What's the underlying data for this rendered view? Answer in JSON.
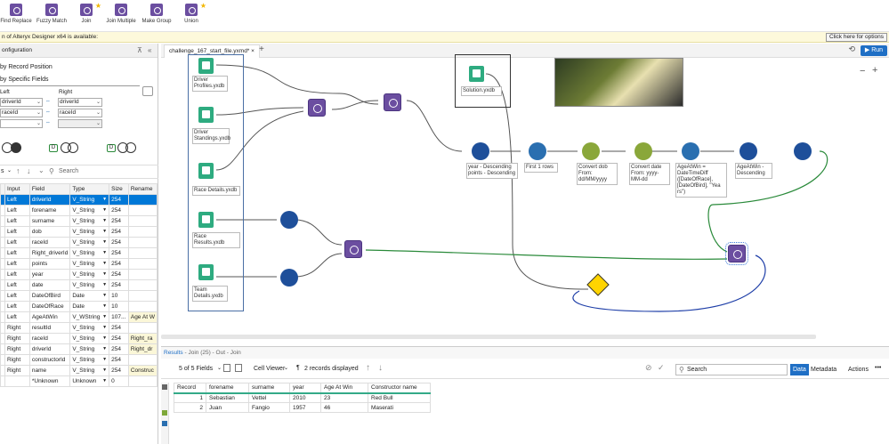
{
  "ribbon": {
    "tools": [
      {
        "label": "Find Replace",
        "starred": false
      },
      {
        "label": "Fuzzy Match",
        "starred": false
      },
      {
        "label": "Join",
        "starred": true
      },
      {
        "label": "Join Multiple",
        "starred": false
      },
      {
        "label": "Make Group",
        "starred": false
      },
      {
        "label": "Union",
        "starred": true
      }
    ]
  },
  "banner": {
    "text": "n of Alteryx Designer x64 is available:",
    "button": "Click here for options"
  },
  "config": {
    "title": "onfiguration",
    "option_position": "by Record Position",
    "option_fields": "by Specific Fields",
    "left_header": "Left",
    "right_header": "Right",
    "join_rows": [
      {
        "left": "driverId",
        "right": "driverId"
      },
      {
        "left": "raceId",
        "right": "raceId"
      },
      {
        "left": "",
        "right": ""
      }
    ],
    "grid_search_placeholder": "Search",
    "grid_toolbar_left": "s",
    "columns": [
      "Input",
      "Field",
      "Type",
      "Size",
      "Rename"
    ],
    "rows": [
      {
        "input": "Left",
        "field": "driverId",
        "type": "V_String",
        "size": "254",
        "rename": "",
        "selected": true
      },
      {
        "input": "Left",
        "field": "forename",
        "type": "V_String",
        "size": "254",
        "rename": ""
      },
      {
        "input": "Left",
        "field": "surname",
        "type": "V_String",
        "size": "254",
        "rename": ""
      },
      {
        "input": "Left",
        "field": "dob",
        "type": "V_String",
        "size": "254",
        "rename": ""
      },
      {
        "input": "Left",
        "field": "raceId",
        "type": "V_String",
        "size": "254",
        "rename": ""
      },
      {
        "input": "Left",
        "field": "Right_driverId",
        "type": "V_String",
        "size": "254",
        "rename": ""
      },
      {
        "input": "Left",
        "field": "points",
        "type": "V_String",
        "size": "254",
        "rename": ""
      },
      {
        "input": "Left",
        "field": "year",
        "type": "V_String",
        "size": "254",
        "rename": ""
      },
      {
        "input": "Left",
        "field": "date",
        "type": "V_String",
        "size": "254",
        "rename": ""
      },
      {
        "input": "Left",
        "field": "DateOfBird",
        "type": "Date",
        "size": "10",
        "rename": ""
      },
      {
        "input": "Left",
        "field": "DateOfRace",
        "type": "Date",
        "size": "10",
        "rename": ""
      },
      {
        "input": "Left",
        "field": "AgeAtWin",
        "type": "V_WString",
        "size": "107...",
        "rename": "Age At W"
      },
      {
        "input": "Right",
        "field": "resultId",
        "type": "V_String",
        "size": "254",
        "rename": ""
      },
      {
        "input": "Right",
        "field": "raceId",
        "type": "V_String",
        "size": "254",
        "rename": "Right_ra"
      },
      {
        "input": "Right",
        "field": "driverId",
        "type": "V_String",
        "size": "254",
        "rename": "Right_dr"
      },
      {
        "input": "Right",
        "field": "constructorId",
        "type": "V_String",
        "size": "254",
        "rename": ""
      },
      {
        "input": "Right",
        "field": "name",
        "type": "V_String",
        "size": "254",
        "rename": "Construc"
      },
      {
        "input": "",
        "field": "*Unknown",
        "type": "Unknown",
        "size": "0",
        "rename": ""
      }
    ]
  },
  "tabs": {
    "active": "challenge_167_start_file.yxmd*",
    "close": "×",
    "add": "+",
    "run": "Run"
  },
  "canvas": {
    "labels": {
      "driver_profiles": "Driver Profiles.yxdb",
      "driver_standings": "Driver Standings.yxdb",
      "race_details": "Race Details.yxdb",
      "race_results": "Race Results.yxdb",
      "team_details": "Team Details.yxdb",
      "solution": "Solution.yxdb",
      "sort": "year - Descending points - Descending",
      "sample": "First 1 rows",
      "convert_dob": "Convert dob From: dd/MM/yyyy",
      "convert_date": "Convert date From: yyyy-MM-dd",
      "formula": "AgeAtWin = DateTimeDiff ([DateOfRace], [DateOfBird], \"Yea rs\")",
      "sort2": "AgeAtWin - Descending"
    },
    "zoom_minus": "−",
    "zoom_plus": "+"
  },
  "results": {
    "title": "Results",
    "subtitle": " - Join (25) - Out - Join",
    "fields_count": "5 of 5 Fields",
    "viewer": "Cell Viewer",
    "records": "2 records displayed",
    "search_placeholder": "Search",
    "btn_data": "Data",
    "btn_metadata": "Metadata",
    "btn_actions": "Actions",
    "columns": [
      "Record",
      "forename",
      "surname",
      "year",
      "Age At Win",
      "Constructor name"
    ],
    "rows": [
      [
        "1",
        "Sebastian",
        "Vettel",
        "2010",
        "23",
        "Red Bull"
      ],
      [
        "2",
        "Juan",
        "Fangio",
        "1957",
        "46",
        "Maserati"
      ]
    ]
  }
}
